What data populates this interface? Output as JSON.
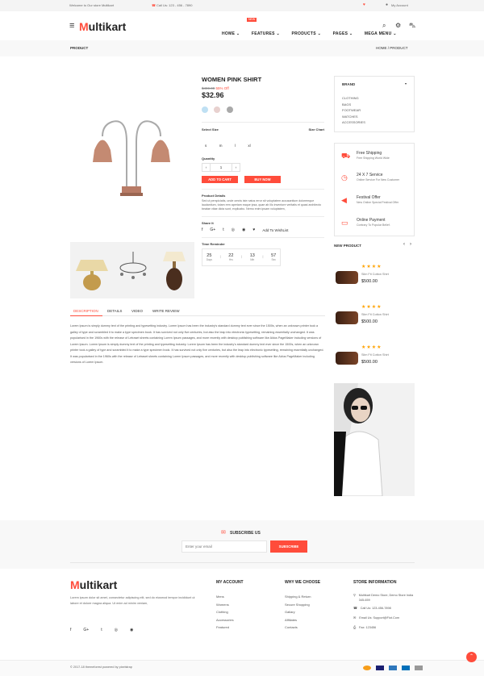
{
  "topbar": {
    "welcome": "Welcome to Our store Multikart",
    "call": "Call Us: 123 - 456 - 7890",
    "account": "My Account"
  },
  "header": {
    "logo_first": "M",
    "logo_rest": "ultikart",
    "nav": [
      "HOME",
      "FEATURES",
      "PRODUCTS",
      "PAGES",
      "MEGA MENU"
    ],
    "new_badge": "NEW"
  },
  "breadcrumb": {
    "title": "PRODUCT",
    "home": "HOME",
    "separator": "/",
    "current": "PRODUCT"
  },
  "product": {
    "name": "WOMEN PINK SHIRT",
    "old_price": "$459.00",
    "discount": "55% Off",
    "price": "$32.96",
    "swatches": [
      "#bfe0f3",
      "#e8d1cf",
      "#a9a9a9"
    ],
    "select_size": "Select Size",
    "size_chart": "Size Chart",
    "sizes": [
      "s",
      "m",
      "l",
      "xl"
    ],
    "quantity_label": "Quantity",
    "quantity": "1",
    "add_to_cart": "ADD TO CART",
    "buy_now": "BUY NOW",
    "details_title": "Product Details",
    "details_text": "Sed ut perspiciatis, unde omnis iste natus error sit voluptatem accusantium doloremque laudantium, totam rem aperiam eaque ipsa, quae ab illo inventore veritatis et quasi architecto beatae vitae dicta sunt, explicabo. Nemo enim ipsam voluptatem,",
    "share_title": "Share It",
    "wishlist": "Add To WishList",
    "timer_title": "Time Reminder",
    "timer": [
      {
        "value": "25",
        "label": "Days"
      },
      {
        "value": "22",
        "label": "Hrs"
      },
      {
        "value": "13",
        "label": "Min"
      },
      {
        "value": "57",
        "label": "Sec"
      }
    ]
  },
  "tabs": [
    "DESCRIPTION",
    "DETAILS",
    "VIDEO",
    "WRITE REVIEW"
  ],
  "description": "Lorem Ipsum is simply dummy text of the printing and typesetting industry. Lorem Ipsum has been the industry's standard dummy text ever since the 1500s, when an unknown printer took a galley of type and scrambled it to make a type specimen book. It has survived not only five centuries, but also the leap into electronic typesetting, remaining essentially unchanged. It was popularised in the 1960s with the release of Letraset sheets containing Lorem Ipsum passages, and more recently with desktop publishing software like Aldus PageMaker including versions of Lorem Ipsum. Lorem Ipsum is simply dummy text of the printing and typesetting industry. Lorem Ipsum has been the industry's standard dummy text ever since the 1500s, when an unknown printer took a galley of type and scrambled it to make a type specimen book. It has survived not only five centuries, but also the leap into electronic typesetting, remaining essentially unchanged. It was popularised in the 1960s with the release of Letraset sheets containing Lorem Ipsum passages, and more recently with desktop publishing software like Aldus PageMaker including versions of Lorem Ipsum.",
  "sidebar": {
    "brand_title": "BRAND",
    "brands": [
      "CLOTHING",
      "BAGS",
      "FOOTWEAR",
      "WATCHES",
      "ACCESSORIES"
    ],
    "services": [
      {
        "title": "Free Shipping",
        "text": "Free Shipping World Wide",
        "icon": "truck-icon"
      },
      {
        "title": "24 X 7 Service",
        "text": "Online Service For New Customer",
        "icon": "clock-icon"
      },
      {
        "title": "Festival Offer",
        "text": "New Online Special Festival Offer",
        "icon": "megaphone-icon"
      },
      {
        "title": "Online Payment",
        "text": "Contrary To Popular Belief.",
        "icon": "payment-icon"
      }
    ],
    "new_product_title": "NEW PRODUCT",
    "new_products": [
      {
        "name": "Slim Fit Cotton Shirt",
        "price": "$500.00",
        "stars": "★★★★"
      },
      {
        "name": "Slim Fit Cotton Shirt",
        "price": "$500.00",
        "stars": "★★★★"
      },
      {
        "name": "Slim Fit Cotton Shirt",
        "price": "$500.00",
        "stars": "★★★★"
      }
    ]
  },
  "subscribe": {
    "title": "SUBSCRIBE US",
    "placeholder": "Enter your email",
    "button": "SUBSCRIBE"
  },
  "footer": {
    "about": "Lorem ipsum dolor sit amet, consectetur adipiscing elit, sed do eiusmod tempor incididunt ut labore et dolore magna aliqua. Ut enim ad minim veniam,",
    "my_account_title": "MY ACCOUNT",
    "my_account": [
      "Mens",
      "Womens",
      "Clothing",
      "Accessories",
      "Featured"
    ],
    "why_title": "WHY WE CHOOSE",
    "why": [
      "Shipping & Return",
      "Secure Shopping",
      "Gallary",
      "Affiliates",
      "Contacts"
    ],
    "store_title": "STORE INFORMATION",
    "store": [
      {
        "icon": "map-pin-icon",
        "text": "Multikart Demo Store, Demo Store India 345-659"
      },
      {
        "icon": "phone-icon",
        "text": "Call Us: 123-456-7898"
      },
      {
        "icon": "mail-icon",
        "text": "Email Us: Support@Fiot.Com"
      },
      {
        "icon": "fax-icon",
        "text": "Fax: 123456"
      }
    ],
    "copyright": "© 2017-18 themeforest powered by pixelstrap"
  },
  "colors": {
    "accent": "#ff4c3b",
    "brand_text": "#222222"
  }
}
